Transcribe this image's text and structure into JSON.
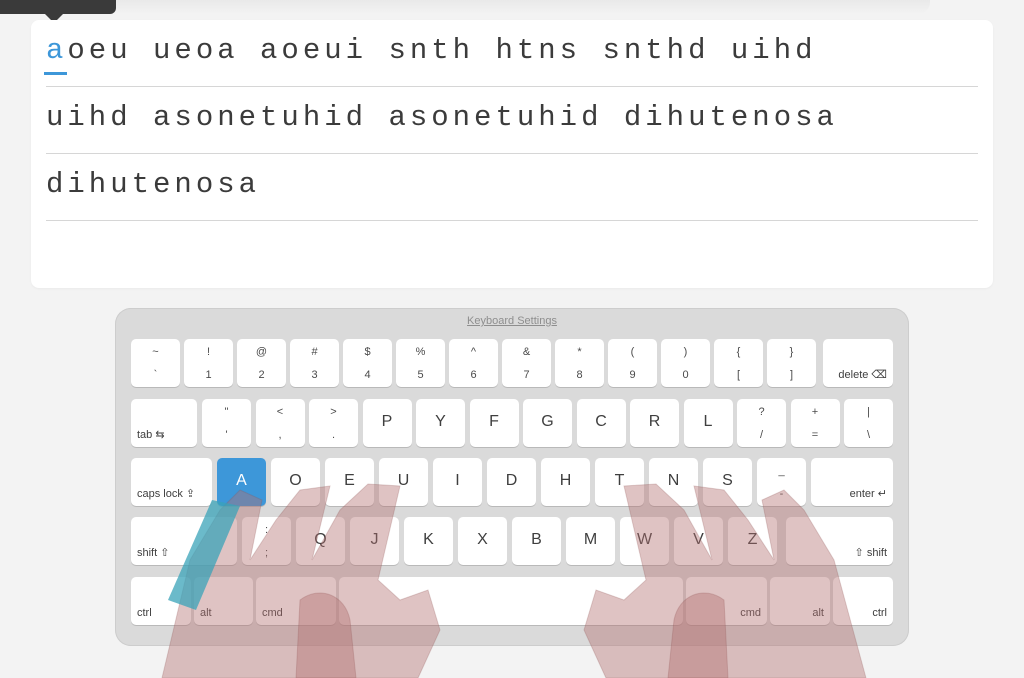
{
  "lesson": {
    "current_char": "a",
    "line1_rest": "oeu ueoa aoeui snth htns snthd uihd",
    "line2": "uihd asonetuhid asonetuhid dihutenosa",
    "line3": "dihutenosa"
  },
  "keyboard": {
    "settings_link": "Keyboard Settings",
    "row1": [
      {
        "top": "~",
        "bot": "`"
      },
      {
        "top": "!",
        "bot": "1"
      },
      {
        "top": "@",
        "bot": "2"
      },
      {
        "top": "#",
        "bot": "3"
      },
      {
        "top": "$",
        "bot": "4"
      },
      {
        "top": "%",
        "bot": "5"
      },
      {
        "top": "^",
        "bot": "6"
      },
      {
        "top": "&",
        "bot": "7"
      },
      {
        "top": "*",
        "bot": "8"
      },
      {
        "top": "(",
        "bot": "9"
      },
      {
        "top": ")",
        "bot": "0"
      },
      {
        "top": "{",
        "bot": "["
      },
      {
        "top": "}",
        "bot": "]"
      }
    ],
    "delete_label": "delete ⌫",
    "tab_label": "tab ⇆",
    "row2": [
      {
        "top": "\"",
        "bot": "'"
      },
      {
        "top": "<",
        "bot": ","
      },
      {
        "top": ">",
        "bot": "."
      },
      {
        "main": "P"
      },
      {
        "main": "Y"
      },
      {
        "main": "F"
      },
      {
        "main": "G"
      },
      {
        "main": "C"
      },
      {
        "main": "R"
      },
      {
        "main": "L"
      },
      {
        "top": "?",
        "bot": "/"
      },
      {
        "top": "+",
        "bot": "="
      },
      {
        "top": "|",
        "bot": "\\"
      }
    ],
    "caps_label": "caps lock ⇪",
    "row3": [
      {
        "main": "A"
      },
      {
        "main": "O"
      },
      {
        "main": "E"
      },
      {
        "main": "U"
      },
      {
        "main": "I"
      },
      {
        "main": "D"
      },
      {
        "main": "H"
      },
      {
        "main": "T"
      },
      {
        "main": "N"
      },
      {
        "main": "S"
      },
      {
        "top": "_",
        "bot": "-"
      }
    ],
    "enter_label": "enter ↵",
    "shift_left_label": "shift ⇧",
    "row4": [
      {
        "top": ":",
        "bot": ";"
      },
      {
        "main": "Q"
      },
      {
        "main": "J"
      },
      {
        "main": "K"
      },
      {
        "main": "X"
      },
      {
        "main": "B"
      },
      {
        "main": "M"
      },
      {
        "main": "W"
      },
      {
        "main": "V"
      },
      {
        "main": "Z"
      }
    ],
    "shift_right_label": "⇧ shift",
    "bottom": {
      "ctrl_left": "ctrl",
      "alt_left": "alt",
      "cmd_left": "cmd",
      "cmd_right": "cmd",
      "alt_right": "alt",
      "ctrl_right": "ctrl"
    },
    "active_key": "A",
    "active_color": "#3d97d9"
  }
}
